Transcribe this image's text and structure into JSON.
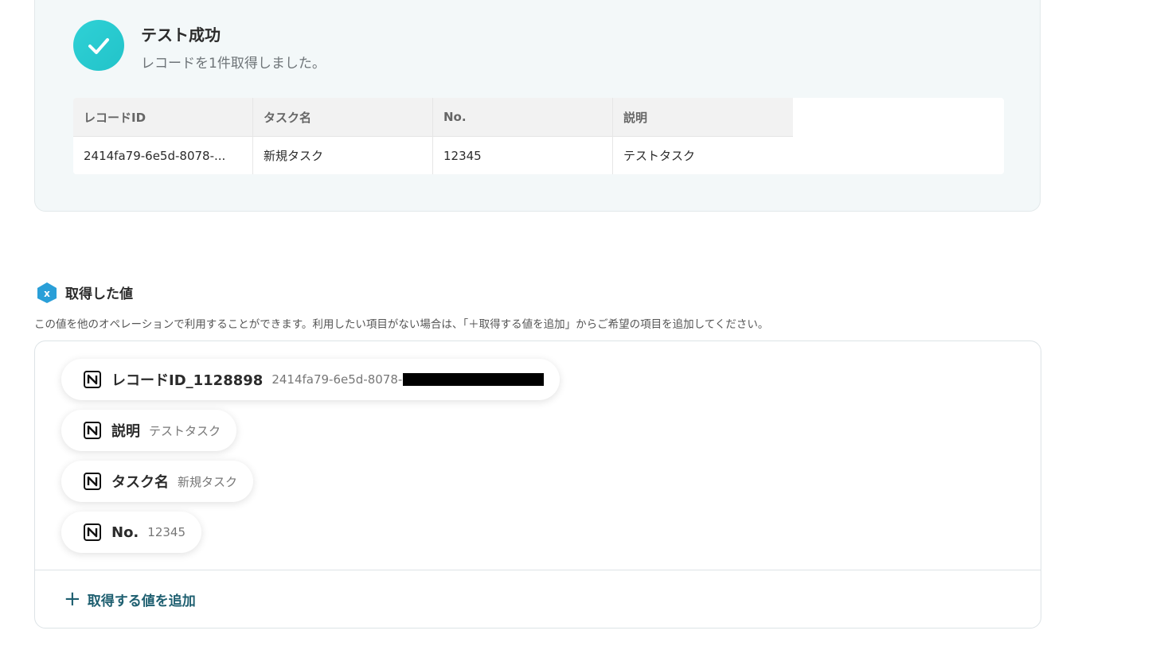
{
  "test_result": {
    "title": "テスト成功",
    "message": "レコードを1件取得しました。",
    "table": {
      "headers": [
        "レコードID",
        "タスク名",
        "No.",
        "説明"
      ],
      "rows": [
        [
          "2414fa79-6e5d-8078-...",
          "新規タスク",
          "12345",
          "テストタスク"
        ]
      ]
    }
  },
  "retrieved_values": {
    "title": "取得した値",
    "description": "この値を他のオペレーションで利用することができます。利用したい項目がない場合は、「＋取得する値を追加」からご希望の項目を追加してください。",
    "items": [
      {
        "label": "レコードID_1128898",
        "value": "2414fa79-6e5d-8078-",
        "icon": "notion-icon"
      },
      {
        "label": "説明",
        "value": "テストタスク",
        "icon": "notion-icon"
      },
      {
        "label": "タスク名",
        "value": "新規タスク",
        "icon": "notion-icon"
      },
      {
        "label": "No.",
        "value": "12345",
        "icon": "notion-icon"
      }
    ],
    "add_button_label": "取得する値を追加"
  },
  "colors": {
    "accent": "#22c3c9",
    "link": "#1e5f70",
    "panel_bg": "#f3f8f9"
  }
}
